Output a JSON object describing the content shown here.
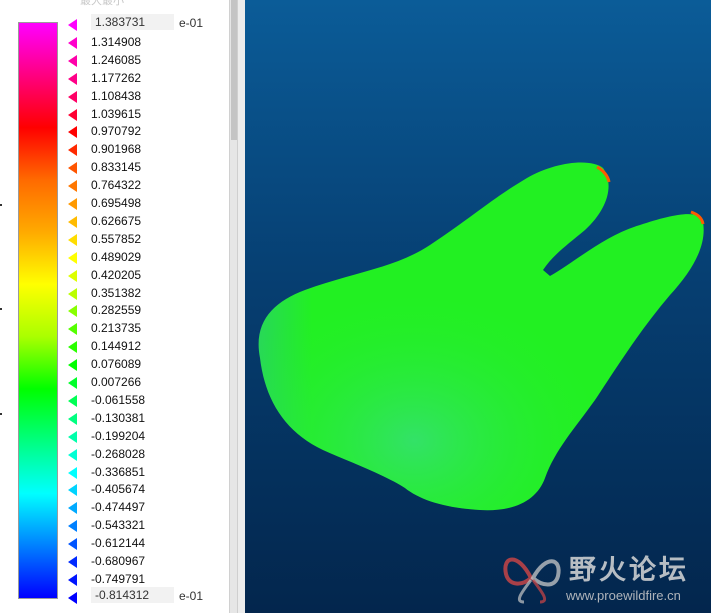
{
  "legend": {
    "header_fragment": "最大最小",
    "exponent": "e-01",
    "gradient": [
      "#ff00ff",
      "#ff0080",
      "#ff0000",
      "#ff6a00",
      "#ffaa00",
      "#ffff00",
      "#aaff00",
      "#00ff00",
      "#00ff80",
      "#00ffff",
      "#0080ff",
      "#0000ff"
    ],
    "entries": [
      {
        "value": "1.383731",
        "color": "#ff00ff"
      },
      {
        "value": "1.314908",
        "color": "#ff00cc"
      },
      {
        "value": "1.246085",
        "color": "#ff00aa"
      },
      {
        "value": "1.177262",
        "color": "#ff0088"
      },
      {
        "value": "1.108438",
        "color": "#ff0066"
      },
      {
        "value": "1.039615",
        "color": "#ff0033"
      },
      {
        "value": "0.970792",
        "color": "#ff0000"
      },
      {
        "value": "0.901968",
        "color": "#ff2a00"
      },
      {
        "value": "0.833145",
        "color": "#ff5500"
      },
      {
        "value": "0.764322",
        "color": "#ff7700"
      },
      {
        "value": "0.695498",
        "color": "#ff9900"
      },
      {
        "value": "0.626675",
        "color": "#ffbb00"
      },
      {
        "value": "0.557852",
        "color": "#ffdd00"
      },
      {
        "value": "0.489029",
        "color": "#ffff00"
      },
      {
        "value": "0.420205",
        "color": "#ddff00"
      },
      {
        "value": "0.351382",
        "color": "#bbff00"
      },
      {
        "value": "0.282559",
        "color": "#88ff00"
      },
      {
        "value": "0.213735",
        "color": "#55ff00"
      },
      {
        "value": "0.144912",
        "color": "#2aff00"
      },
      {
        "value": "0.076089",
        "color": "#00ff00"
      },
      {
        "value": "0.007266",
        "color": "#00ff2a"
      },
      {
        "value": "-0.061558",
        "color": "#00ff55"
      },
      {
        "value": "-0.130381",
        "color": "#00ff80"
      },
      {
        "value": "-0.199204",
        "color": "#00ffaa"
      },
      {
        "value": "-0.268028",
        "color": "#00ffd4"
      },
      {
        "value": "-0.336851",
        "color": "#00ffff"
      },
      {
        "value": "-0.405674",
        "color": "#00d4ff"
      },
      {
        "value": "-0.474497",
        "color": "#00aaff"
      },
      {
        "value": "-0.543321",
        "color": "#0080ff"
      },
      {
        "value": "-0.612144",
        "color": "#0055ff"
      },
      {
        "value": "-0.680967",
        "color": "#002aff"
      },
      {
        "value": "-0.749791",
        "color": "#0015ff"
      },
      {
        "value": "-0.814312",
        "color": "#0000ff"
      }
    ]
  },
  "viewport": {
    "background_top": "#0b5c98",
    "background_bottom": "#03264d",
    "model_color": "#22f022",
    "model_shade": "#3ad890",
    "hotspot_color": "#ff3300"
  },
  "watermark": {
    "title": "野火论坛",
    "url": "www.proewildfire.cn",
    "logo_icon": "butterfly-logo-icon"
  }
}
